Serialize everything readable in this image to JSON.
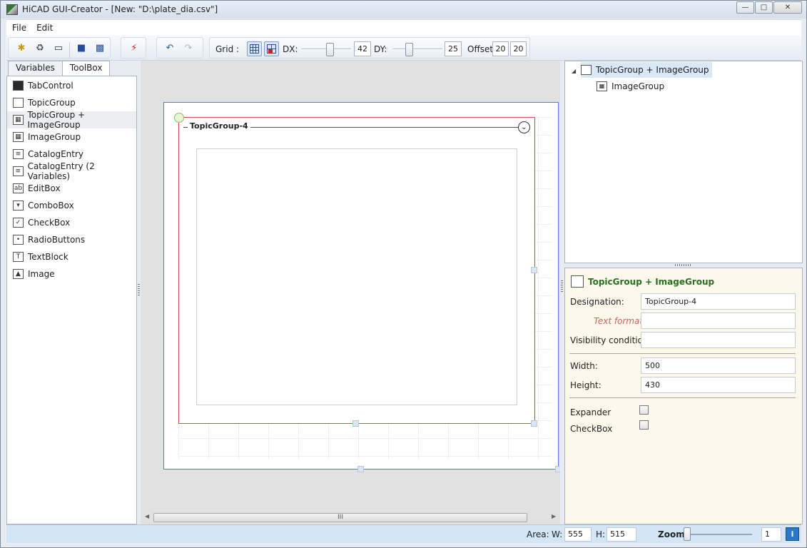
{
  "window": {
    "title": "HiCAD GUI-Creator - [New: \"D:\\plate_dia.csv\"]"
  },
  "menu": {
    "items": [
      "File",
      "Edit"
    ]
  },
  "toolbar": {
    "grid_label": "Grid :",
    "dx_label": "DX:",
    "dx_value": "42",
    "dx_slider_fraction": 0.6,
    "dy_label": "DY:",
    "dy_value": "25",
    "dy_slider_fraction": 0.3,
    "offset_label": "Offset:",
    "offset_x": "20",
    "offset_y": "20"
  },
  "left_panel": {
    "tabs": [
      "Variables",
      "ToolBox"
    ],
    "active_tab": "ToolBox",
    "items": [
      {
        "label": "TabControl",
        "icon": "tabcontrol-icon"
      },
      {
        "label": "TopicGroup",
        "icon": "topicgroup-icon"
      },
      {
        "label": "TopicGroup + ImageGroup",
        "icon": "topicgroup-imagegroup-icon",
        "selected": true
      },
      {
        "label": "ImageGroup",
        "icon": "imagegroup-icon"
      },
      {
        "label": "CatalogEntry",
        "icon": "catalogentry-icon"
      },
      {
        "label": "CatalogEntry (2 Variables)",
        "icon": "catalogentry-2-icon"
      },
      {
        "label": "EditBox",
        "icon": "editbox-icon"
      },
      {
        "label": "ComboBox",
        "icon": "combobox-icon"
      },
      {
        "label": "CheckBox",
        "icon": "checkbox-icon"
      },
      {
        "label": "RadioButtons",
        "icon": "radiobuttons-icon"
      },
      {
        "label": "TextBlock",
        "icon": "textblock-icon"
      },
      {
        "label": "Image",
        "icon": "image-icon"
      }
    ]
  },
  "canvas": {
    "topic_title": "TopicGroup-4",
    "scroll_grip": "III"
  },
  "tree": {
    "items": [
      {
        "label": "TopicGroup + ImageGroup",
        "selected": true
      },
      {
        "label": "ImageGroup",
        "selected": false
      }
    ]
  },
  "properties": {
    "header": "TopicGroup + ImageGroup",
    "designation_label": "Designation:",
    "designation_value": "TopicGroup-4",
    "text_format_label": "Text format:",
    "text_format_value": "",
    "visibility_label": "Visibility condition:",
    "visibility_value": "",
    "width_label": "Width:",
    "width_value": "500",
    "height_label": "Height:",
    "height_value": "430",
    "expander_label": "Expander",
    "expander_checked": false,
    "checkbox_label": "CheckBox",
    "checkbox_checked": false
  },
  "status": {
    "area_label": "Area:",
    "w_label": "W:",
    "w_value": "555",
    "h_label": "H:",
    "h_value": "515",
    "zoom_label": "Zoom:",
    "zoom_value": "1",
    "zoom_slider_fraction": 0.0
  },
  "colors": {
    "selection_border": "#e04848",
    "page_border": "#5d74e8",
    "props_title": "#2c6e22",
    "text_format_label": "#d06060"
  }
}
